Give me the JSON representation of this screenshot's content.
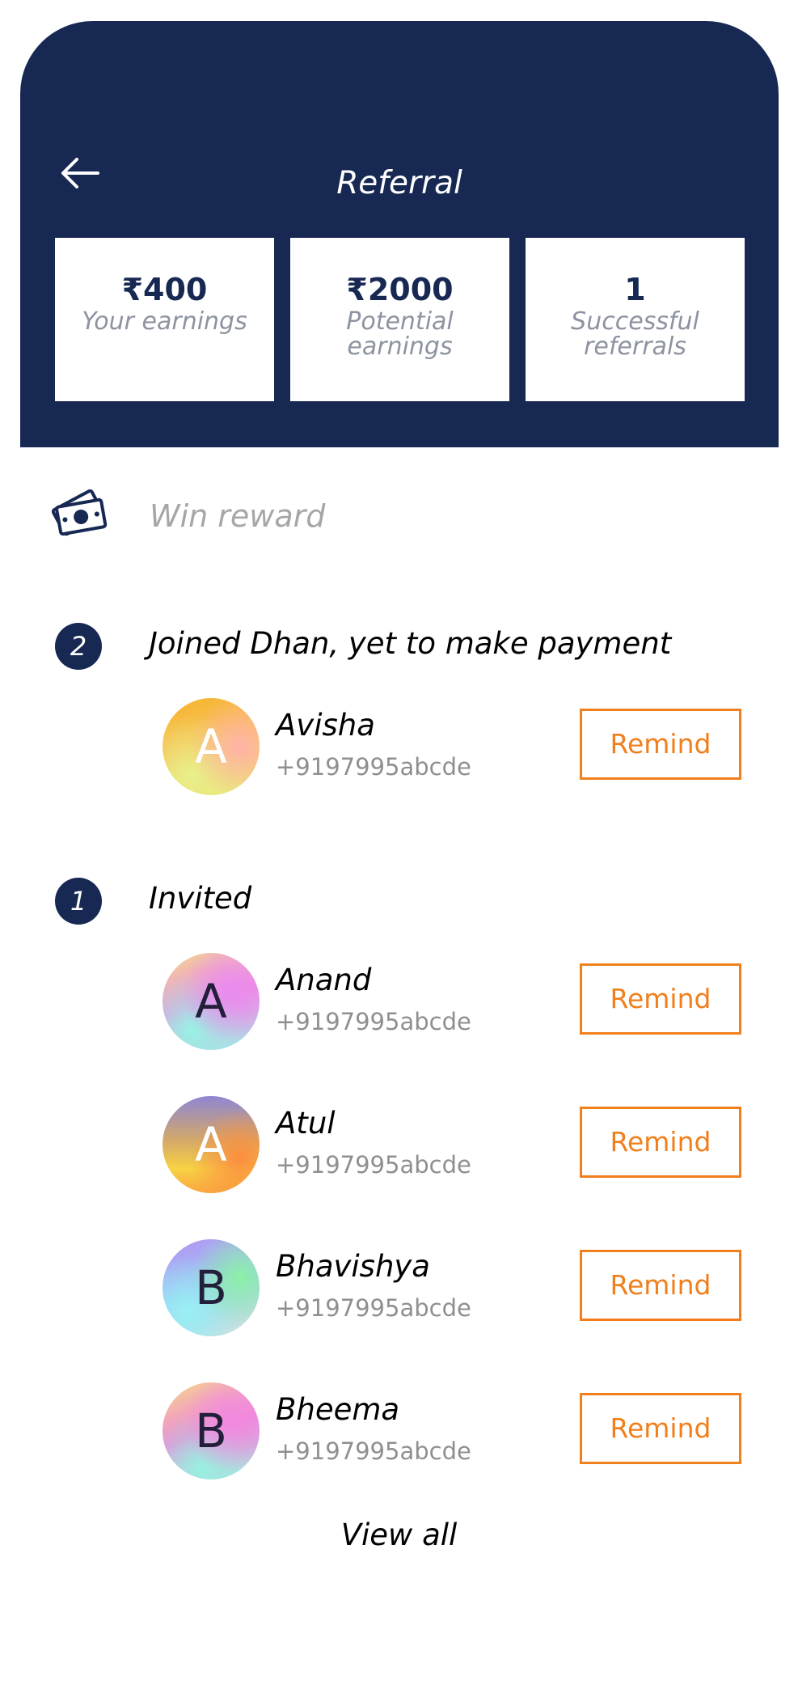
{
  "header": {
    "title": "Referral",
    "back_icon": "arrow-left-icon",
    "background_color": "#172853"
  },
  "stats": [
    {
      "value": "₹400",
      "label": "Your earnings"
    },
    {
      "value": "₹2000",
      "label": "Potential earnings"
    },
    {
      "value": "1",
      "label": "Successful referrals"
    }
  ],
  "reward": {
    "label": "Win reward",
    "icon": "money-icon"
  },
  "sections": {
    "joined": {
      "count": "2",
      "title": "Joined Dhan, yet to make payment",
      "contacts": [
        {
          "initial": "A",
          "name": "Avisha",
          "phone": "+9197995abcde",
          "button": "Remind"
        }
      ]
    },
    "invited": {
      "count": "1",
      "title": "Invited",
      "contacts": [
        {
          "initial": "A",
          "name": "Anand",
          "phone": "+9197995abcde",
          "button": "Remind"
        },
        {
          "initial": "A",
          "name": "Atul",
          "phone": "+9197995abcde",
          "button": "Remind"
        },
        {
          "initial": "B",
          "name": "Bhavishya",
          "phone": "+9197995abcde",
          "button": "Remind"
        },
        {
          "initial": "B",
          "name": "Bheema",
          "phone": "+9197995abcde",
          "button": "Remind"
        }
      ]
    }
  },
  "view_all": "View all",
  "colors": {
    "accent": "#f07f1c",
    "navy": "#172853",
    "muted": "#8f8f8f"
  }
}
